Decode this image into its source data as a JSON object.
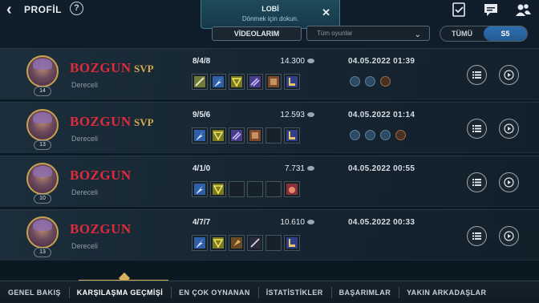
{
  "header": {
    "back_label": "PROFİL",
    "help_icon": "?",
    "icons": [
      "checklist-icon",
      "chat-icon",
      "friends-icon"
    ]
  },
  "lobby": {
    "title": "LOBİ",
    "subtitle": "Dönmek için dokun.",
    "close": "✕"
  },
  "filters": {
    "video_label": "VİDEOLARIM",
    "dropdown_value": "Tüm oyunlar",
    "segments": [
      {
        "label": "TÜMÜ",
        "active": false
      },
      {
        "label": "S5",
        "active": true
      }
    ]
  },
  "matches": [
    {
      "name": "BOZGUN",
      "badge": "SVP",
      "mode": "Dereceli",
      "level": "14",
      "kda": "8/4/8",
      "gold": "14.300",
      "date": "04.05.2022 01:39",
      "items": 6,
      "spells": [
        "blue",
        "blue",
        "fire"
      ]
    },
    {
      "name": "BOZGUN",
      "badge": "SVP",
      "mode": "Dereceli",
      "level": "13",
      "kda": "9/5/6",
      "gold": "12.593",
      "date": "04.05.2022 01:14",
      "items": 5,
      "spells": [
        "blue",
        "blue",
        "blue",
        "fire"
      ]
    },
    {
      "name": "BOZGUN",
      "badge": "",
      "mode": "Dereceli",
      "level": "10",
      "kda": "4/1/0",
      "gold": "7.731",
      "date": "04.05.2022 00:55",
      "items": 3,
      "spells": []
    },
    {
      "name": "BOZGUN",
      "badge": "",
      "mode": "Dereceli",
      "level": "13",
      "kda": "4/7/7",
      "gold": "10.610",
      "date": "04.05.2022 00:33",
      "items": 6,
      "spells": []
    }
  ],
  "bottom_nav": [
    {
      "label": "GENEL BAKIŞ",
      "active": false
    },
    {
      "label": "KARŞILAŞMA GEÇMİŞİ",
      "active": true
    },
    {
      "label": "EN ÇOK OYNANAN",
      "active": false
    },
    {
      "label": "İSTATİSTİKLER",
      "active": false
    },
    {
      "label": "BAŞARIMLAR",
      "active": false
    },
    {
      "label": "YAKIN ARKADAŞLAR",
      "active": false
    }
  ],
  "colors": {
    "player_name": "#e02b3c",
    "badge": "#d4a94a",
    "accent": "#d6b25e",
    "segment_active": "#2d6fb0"
  }
}
